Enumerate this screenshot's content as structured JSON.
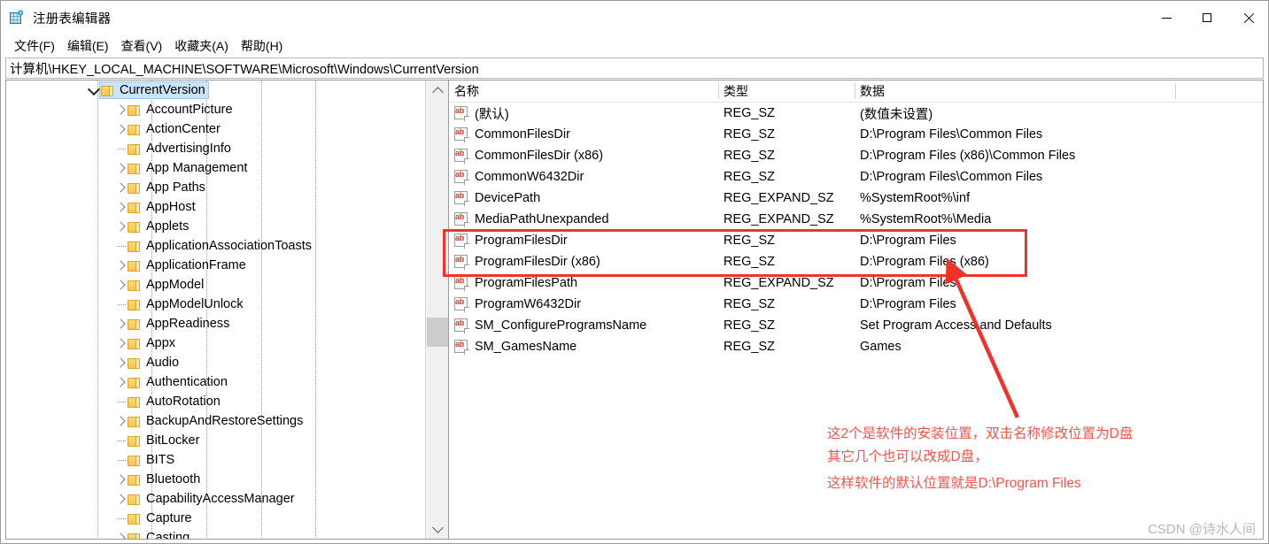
{
  "window": {
    "title": "注册表编辑器",
    "icon": "registry-icon",
    "controls": {
      "minimize": "minimize-icon",
      "maximize": "maximize-icon",
      "close": "close-icon"
    }
  },
  "menubar": {
    "items": [
      {
        "label": "文件(F)"
      },
      {
        "label": "编辑(E)"
      },
      {
        "label": "查看(V)"
      },
      {
        "label": "收藏夹(A)"
      },
      {
        "label": "帮助(H)"
      }
    ]
  },
  "address": {
    "path": "计算机\\HKEY_LOCAL_MACHINE\\SOFTWARE\\Microsoft\\Windows\\CurrentVersion"
  },
  "tree": {
    "nodes": [
      {
        "label": "CurrentVersion",
        "indent": 0,
        "state": "expanded",
        "selected": true
      },
      {
        "label": "AccountPicture",
        "indent": 1,
        "state": "collapsed",
        "selected": false
      },
      {
        "label": "ActionCenter",
        "indent": 1,
        "state": "collapsed",
        "selected": false
      },
      {
        "label": "AdvertisingInfo",
        "indent": 1,
        "state": "leaf",
        "selected": false
      },
      {
        "label": "App Management",
        "indent": 1,
        "state": "collapsed",
        "selected": false
      },
      {
        "label": "App Paths",
        "indent": 1,
        "state": "collapsed",
        "selected": false
      },
      {
        "label": "AppHost",
        "indent": 1,
        "state": "collapsed",
        "selected": false
      },
      {
        "label": "Applets",
        "indent": 1,
        "state": "collapsed",
        "selected": false
      },
      {
        "label": "ApplicationAssociationToasts",
        "indent": 1,
        "state": "leaf",
        "selected": false
      },
      {
        "label": "ApplicationFrame",
        "indent": 1,
        "state": "collapsed",
        "selected": false
      },
      {
        "label": "AppModel",
        "indent": 1,
        "state": "collapsed",
        "selected": false
      },
      {
        "label": "AppModelUnlock",
        "indent": 1,
        "state": "leaf",
        "selected": false
      },
      {
        "label": "AppReadiness",
        "indent": 1,
        "state": "collapsed",
        "selected": false
      },
      {
        "label": "Appx",
        "indent": 1,
        "state": "collapsed",
        "selected": false
      },
      {
        "label": "Audio",
        "indent": 1,
        "state": "collapsed",
        "selected": false
      },
      {
        "label": "Authentication",
        "indent": 1,
        "state": "collapsed",
        "selected": false
      },
      {
        "label": "AutoRotation",
        "indent": 1,
        "state": "leaf",
        "selected": false
      },
      {
        "label": "BackupAndRestoreSettings",
        "indent": 1,
        "state": "collapsed",
        "selected": false
      },
      {
        "label": "BitLocker",
        "indent": 1,
        "state": "leaf",
        "selected": false
      },
      {
        "label": "BITS",
        "indent": 1,
        "state": "leaf",
        "selected": false
      },
      {
        "label": "Bluetooth",
        "indent": 1,
        "state": "collapsed",
        "selected": false
      },
      {
        "label": "CapabilityAccessManager",
        "indent": 1,
        "state": "collapsed",
        "selected": false
      },
      {
        "label": "Capture",
        "indent": 1,
        "state": "leaf",
        "selected": false
      },
      {
        "label": "Casting",
        "indent": 1,
        "state": "collapsed",
        "selected": false
      }
    ]
  },
  "values": {
    "columns": [
      {
        "label": "名称"
      },
      {
        "label": "类型"
      },
      {
        "label": "数据"
      }
    ],
    "rows": [
      {
        "name": "(默认)",
        "type": "REG_SZ",
        "data": "(数值未设置)"
      },
      {
        "name": "CommonFilesDir",
        "type": "REG_SZ",
        "data": "D:\\Program Files\\Common Files"
      },
      {
        "name": "CommonFilesDir (x86)",
        "type": "REG_SZ",
        "data": "D:\\Program Files (x86)\\Common Files"
      },
      {
        "name": "CommonW6432Dir",
        "type": "REG_SZ",
        "data": "D:\\Program Files\\Common Files"
      },
      {
        "name": "DevicePath",
        "type": "REG_EXPAND_SZ",
        "data": "%SystemRoot%\\inf"
      },
      {
        "name": "MediaPathUnexpanded",
        "type": "REG_EXPAND_SZ",
        "data": "%SystemRoot%\\Media"
      },
      {
        "name": "ProgramFilesDir",
        "type": "REG_SZ",
        "data": "D:\\Program Files"
      },
      {
        "name": "ProgramFilesDir (x86)",
        "type": "REG_SZ",
        "data": "D:\\Program Files (x86)"
      },
      {
        "name": "ProgramFilesPath",
        "type": "REG_EXPAND_SZ",
        "data": "D:\\Program Files"
      },
      {
        "name": "ProgramW6432Dir",
        "type": "REG_SZ",
        "data": "D:\\Program Files"
      },
      {
        "name": "SM_ConfigureProgramsName",
        "type": "REG_SZ",
        "data": "Set Program Access and Defaults"
      },
      {
        "name": "SM_GamesName",
        "type": "REG_SZ",
        "data": "Games"
      }
    ]
  },
  "annotation": {
    "color": "#f0564c",
    "box_color": "#f0332a",
    "lines": [
      "这2个是软件的安装位置，双击名称修改位置为D盘",
      "其它几个也可以改成D盘，",
      "这样软件的默认位置就是D:\\Program Files"
    ]
  },
  "watermark": {
    "text": "CSDN @诗水人间"
  }
}
